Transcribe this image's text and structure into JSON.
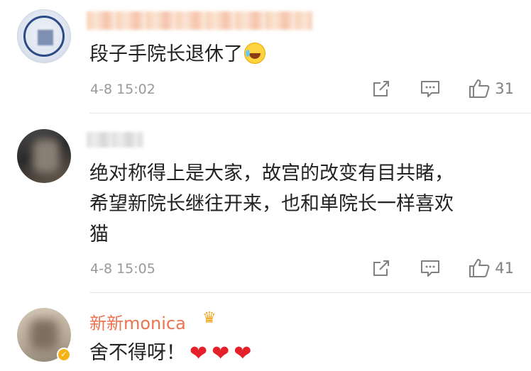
{
  "comments": [
    {
      "name": "",
      "text": "段子手院长退休了",
      "emoji": "laughing-crying-emoji",
      "date": "4-8 15:02",
      "likes": "31"
    },
    {
      "name": "",
      "text_lines": [
        "绝对称得上是大家，故宫的改变有目共睹，",
        "希望新院长继往开来，也和单院长一样喜欢",
        "猫"
      ],
      "date": "4-8 15:05",
      "likes": "41"
    },
    {
      "name": "新新monica",
      "badge_icon": "crown-icon",
      "verified_icon": "verified-badge-icon",
      "text": "舍不得呀！",
      "hearts": [
        "❤",
        "❤",
        "❤"
      ]
    }
  ],
  "icons": {
    "share": "share-icon",
    "comment": "comment-icon",
    "like": "thumbs-up-icon"
  },
  "colors": {
    "name_highlight": "#eb7350",
    "meta_grey": "#999999",
    "heart_red": "#e5202a"
  }
}
